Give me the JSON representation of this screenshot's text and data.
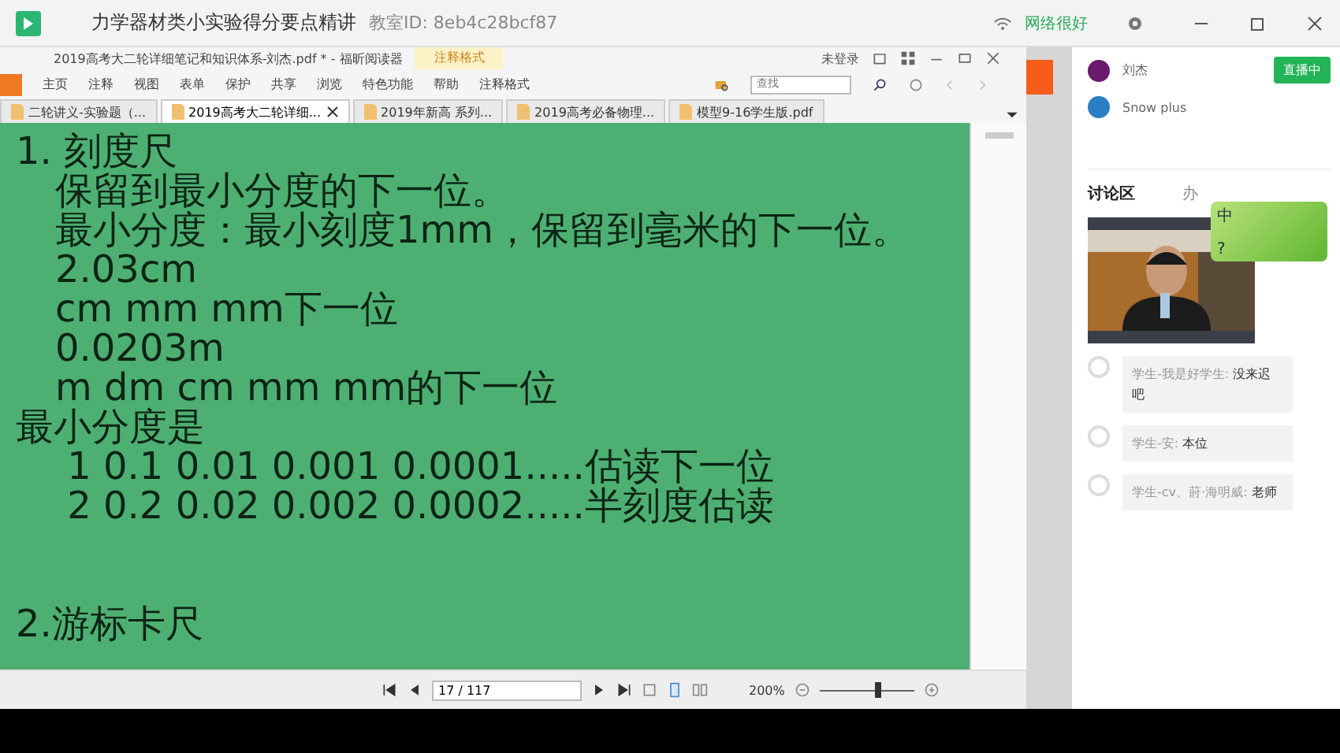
{
  "window": {
    "title": "力学器材类小实验得分要点精讲",
    "room_label": "教室ID:",
    "room_id": "8eb4c28bcf87",
    "network": "网络很好"
  },
  "reader": {
    "title": "2019高考大二轮详细笔记和知识体系-刘杰.pdf * - 福昕阅读器",
    "context_tab": "注释格式",
    "login": "未登录",
    "menu": [
      "主页",
      "注释",
      "视图",
      "表单",
      "保护",
      "共享",
      "浏览",
      "特色功能",
      "帮助",
      "注释格式"
    ],
    "search": {
      "placeholder": "查找"
    },
    "tabs": [
      {
        "label": "二轮讲义-实验题（...",
        "selected": false,
        "closable": false
      },
      {
        "label": "2019高考大二轮详细...",
        "selected": true,
        "closable": true
      },
      {
        "label": "2019年新高  系列...",
        "selected": false,
        "closable": false
      },
      {
        "label": "2019高考必备物理...",
        "selected": false,
        "closable": false
      },
      {
        "label": "模型9-16学生版.pdf",
        "selected": false,
        "closable": false
      }
    ],
    "lines": [
      {
        "kind": "text",
        "text": "1. 刻度尺",
        "indented": false
      },
      {
        "kind": "text",
        "text": "保留到最小分度的下一位。",
        "indented": true
      },
      {
        "kind": "text",
        "text": "最小分度：最小刻度1mm，保留到毫米的下一位。",
        "indented": true
      },
      {
        "kind": "text",
        "text": "2.03cm",
        "indented": true
      },
      {
        "kind": "text",
        "text": "cm mm mm下一位",
        "indented": true
      },
      {
        "kind": "text",
        "text": "0.0203m",
        "indented": true
      },
      {
        "kind": "text",
        "text": "m dm cm mm mm的下一位",
        "indented": true
      },
      {
        "kind": "text",
        "text": "最小分度是",
        "indented": false
      },
      {
        "kind": "text",
        "text": " 1 0.1 0.01 0.001 0.0001.....估读下一位",
        "indented": true
      },
      {
        "kind": "text",
        "text": " 2 0.2 0.02 0.002 0.0002.....半刻度估读",
        "indented": true
      },
      {
        "kind": "blank"
      },
      {
        "kind": "blank"
      },
      {
        "kind": "text",
        "text": "2.游标卡尺",
        "indented": false
      }
    ],
    "page": "17 / 117",
    "zoom": "200%",
    "zoom_slider": {
      "level": 0.62
    }
  },
  "panel": {
    "users": [
      {
        "name": "刘杰",
        "badge": "直播中",
        "color": "#6a1b6e"
      },
      {
        "name": "Snow plus",
        "color": "#2a7fc4"
      }
    ],
    "tabs": [
      {
        "label": "讨论区",
        "selected": true
      },
      {
        "label": "办",
        "selected": false
      }
    ],
    "ime": {
      "mode": "中",
      "help": "?"
    },
    "messages": [
      {
        "sender": "学生-我是好学生:",
        "text": "没来迟吧"
      },
      {
        "sender": "学生-安:",
        "text": "本位"
      },
      {
        "sender": "学生-cv、莳·海明威:",
        "text": "老师"
      }
    ]
  }
}
